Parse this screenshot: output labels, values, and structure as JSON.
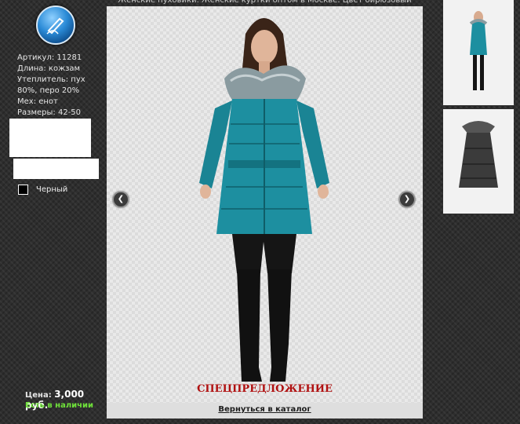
{
  "page_title": "Женские пуховики. Женские куртки оптом в Москве. Цвет бирюзовый",
  "specs": {
    "article": "Артикул: 11281",
    "length": "Длина: кожзам",
    "insulation": "Утеплитель: пух 80%, перо 20%",
    "fur": "Мех: енот",
    "sizes": "Размеры: 42-50"
  },
  "color_option": {
    "label": "Черный",
    "swatch": "#000000"
  },
  "price": {
    "label": "Цена:",
    "value": "3,000 руб."
  },
  "stock": "Есть в наличии",
  "special_offer": "СПЕЦПРЕДЛОЖЕНИЕ",
  "back_link": "Вернуться в каталог",
  "colors": {
    "jacket": "#1d8fa0",
    "special": "#b01010",
    "stock": "#6fe23a"
  },
  "icons": {
    "logo": "pen-logo-icon",
    "prev": "chevron-left-icon",
    "next": "chevron-right-icon"
  }
}
